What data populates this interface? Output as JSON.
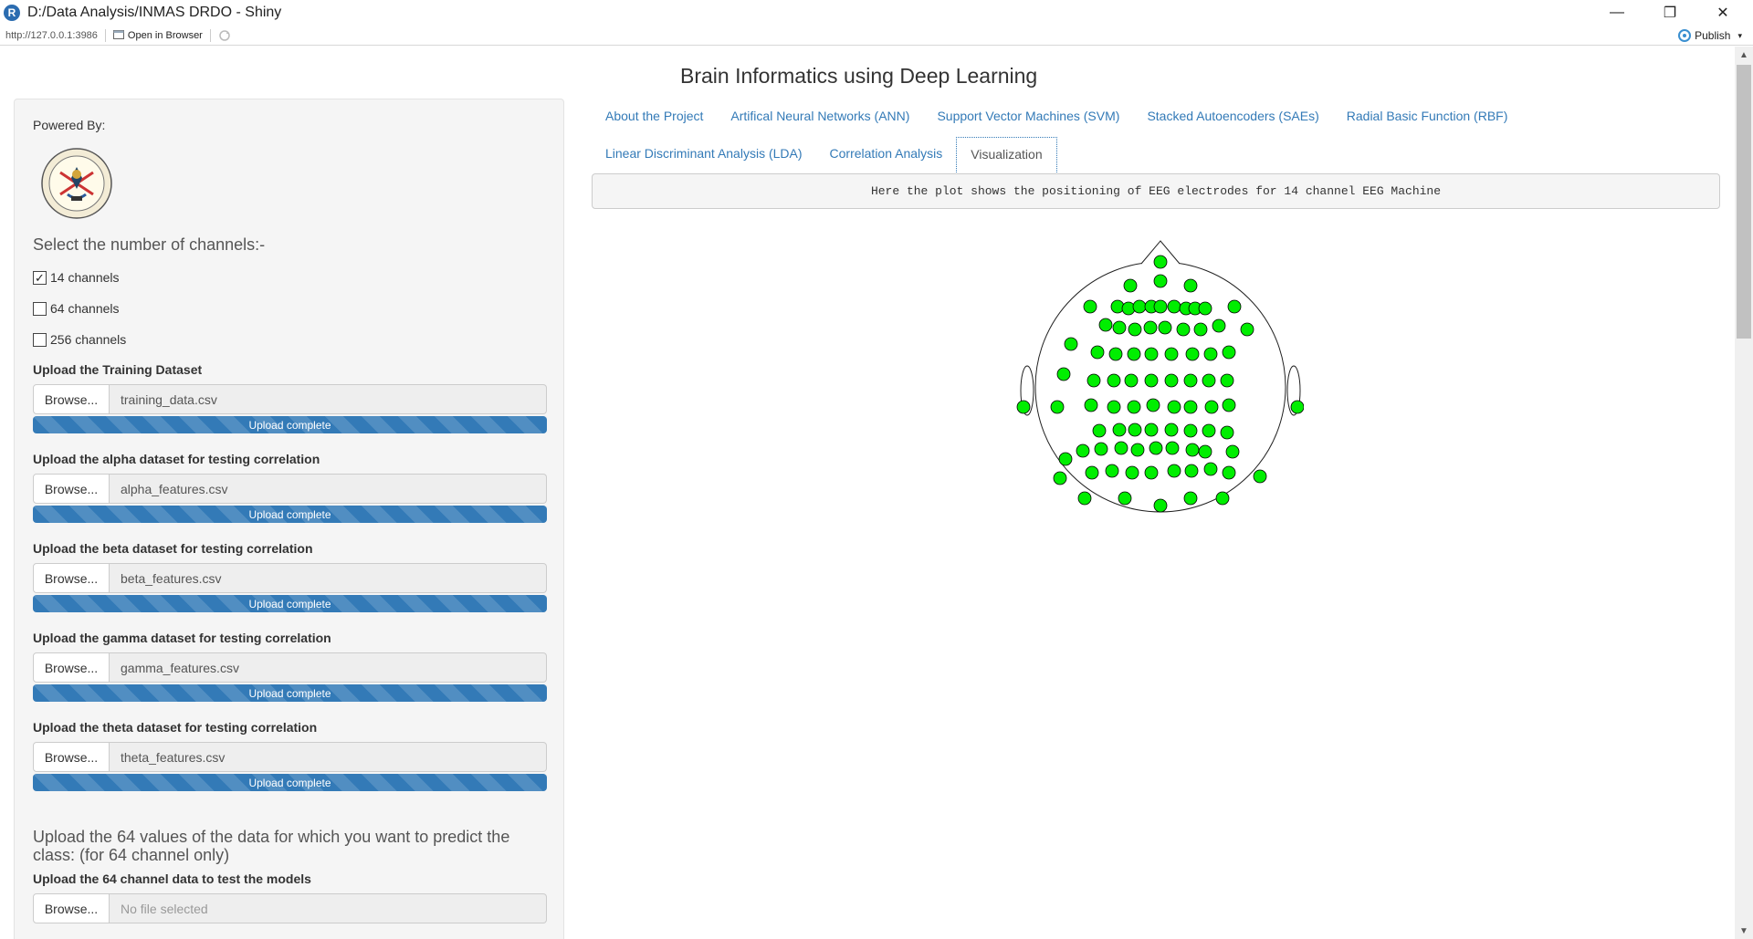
{
  "window": {
    "title": "D:/Data Analysis/INMAS DRDO - Shiny",
    "app_icon": "R",
    "minimize_icon": "—",
    "maximize_icon": "❐",
    "close_icon": "✕"
  },
  "toolbar": {
    "url": "http://127.0.0.1:3986",
    "open_in_browser": "Open in Browser",
    "publish": "Publish"
  },
  "page": {
    "title": "Brain Informatics using Deep Learning"
  },
  "sidebar": {
    "powered_by": "Powered By:",
    "logo_text": "DEFENCE R&D ORGANISATION · MINISTRY OF DEFENCE",
    "channels_heading": "Select the number of channels:-",
    "channels": [
      {
        "label": "14 channels",
        "checked": true
      },
      {
        "label": "64 channels",
        "checked": false
      },
      {
        "label": "256 channels",
        "checked": false
      }
    ],
    "browse_label": "Browse...",
    "uploads": [
      {
        "label": "Upload the Training Dataset",
        "file": "training_data.csv",
        "status": "Upload complete",
        "progress_percent": 100
      },
      {
        "label": "Upload the alpha dataset for testing correlation",
        "file": "alpha_features.csv",
        "status": "Upload complete",
        "progress_percent": 100
      },
      {
        "label": "Upload the beta dataset for testing correlation",
        "file": "beta_features.csv",
        "status": "Upload complete",
        "progress_percent": 100
      },
      {
        "label": "Upload the gamma dataset for testing correlation",
        "file": "gamma_features.csv",
        "status": "Upload complete",
        "progress_percent": 100
      },
      {
        "label": "Upload the theta dataset for testing correlation",
        "file": "theta_features.csv",
        "status": "Upload complete",
        "progress_percent": 100
      }
    ],
    "predict_heading": "Upload the 64 values of the data for which you want to predict the class: (for 64 channel only)",
    "predict_upload": {
      "label": "Upload the 64 channel data to test the models",
      "placeholder": "No file selected"
    }
  },
  "tabs": {
    "row1": [
      "About the Project",
      "Artifical Neural Networks (ANN)",
      "Support Vector Machines (SVM)",
      "Stacked Autoencoders (SAEs)",
      "Radial Basic Function (RBF)"
    ],
    "row2": [
      "Linear Discriminant Analysis (LDA)",
      "Correlation Analysis",
      "Visualization"
    ],
    "active": "Visualization"
  },
  "visualization": {
    "description": "Here the plot shows the positioning of EEG electrodes for 14 channel EEG Machine",
    "electrode_color": "#00ee00",
    "electrode_count": 80
  },
  "colors": {
    "link": "#337ab7",
    "progress": "#337ab7"
  }
}
